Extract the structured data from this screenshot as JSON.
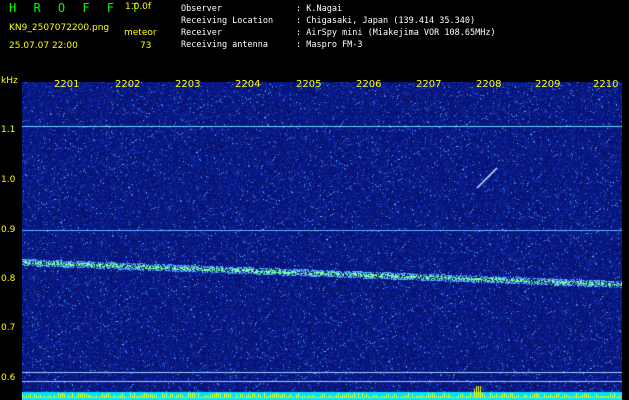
{
  "brand": "H R O F F T",
  "version": "1.0.0f",
  "file": "KN9_2507072200.png",
  "meteor_label": "meteor",
  "datetime": "25.07.07 22:00",
  "meteor_count": "73",
  "info": [
    {
      "label": "Observer",
      "value": ": K.Nagai"
    },
    {
      "label": "Receiving Location",
      "value": ": Chigasaki, Japan (139.414 35.340)"
    },
    {
      "label": "Receiver",
      "value": ": AirSpy mini (Miakejima VOR 108.65MHz)"
    },
    {
      "label": "Receiving antenna",
      "value": ": Maspro FM-3"
    }
  ],
  "y_axis": {
    "unit": "kHz",
    "ticks": [
      "1.1",
      "1.0",
      "0.9",
      "0.8",
      "0.7",
      "0.6"
    ]
  },
  "x_axis": {
    "ticks": [
      "2201",
      "2202",
      "2203",
      "2204",
      "2205",
      "2206",
      "2207",
      "2208",
      "2209",
      "2210"
    ]
  },
  "colors": {
    "background": "#0a1a8c",
    "carrier": "#9adfff",
    "text_yellow": "#ffff00",
    "text_green": "#00ff00",
    "bottom_strip": "#00e5ff"
  }
}
